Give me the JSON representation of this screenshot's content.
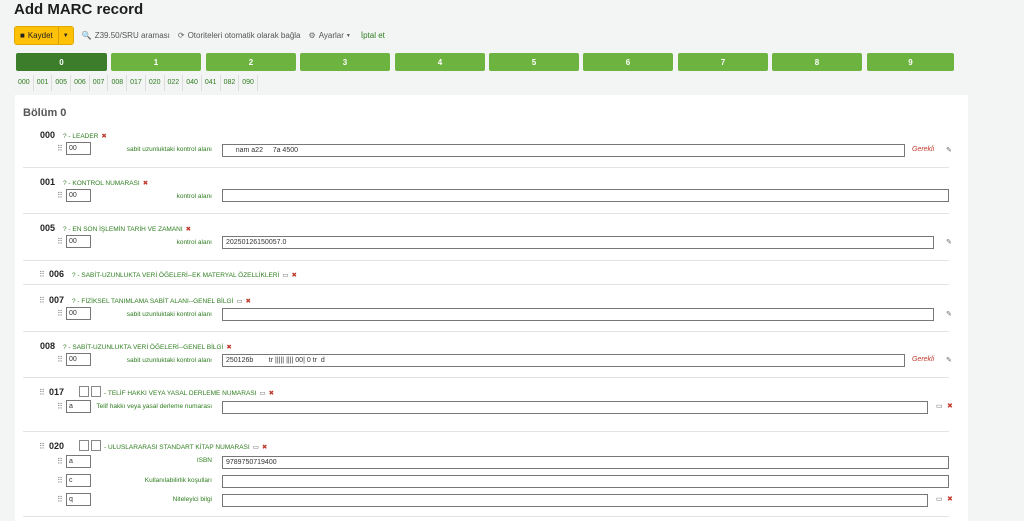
{
  "title": "Add MARC record",
  "toolbar": {
    "save_label": "Kaydet",
    "z3950_label": "Z39.50/SRU araması",
    "link_authorities_label": "Otoriteleri otomatik olarak bağla",
    "settings_label": "Ayarlar",
    "cancel_label": "İptal et"
  },
  "tabs": [
    "0",
    "1",
    "2",
    "3",
    "4",
    "5",
    "6",
    "7",
    "8",
    "9"
  ],
  "fieldnav": [
    "000",
    "001",
    "005",
    "006",
    "007",
    "008",
    "017",
    "020",
    "022",
    "040",
    "041",
    "082",
    "090"
  ],
  "section_title": "Bölüm 0",
  "fields": {
    "f000": {
      "tag": "000",
      "name": "? - LEADER",
      "code": "00",
      "label": "sabit uzunluktaki kontrol alanı",
      "value": "     nam a22     7a 4500",
      "required": "Gerekli"
    },
    "f001": {
      "tag": "001",
      "name": "? - KONTROL NUMARASI",
      "code": "00",
      "label": "kontrol alanı",
      "value": ""
    },
    "f005": {
      "tag": "005",
      "name": "? - EN SON İŞLEMİN TARİH VE ZAMANI",
      "code": "00",
      "label": "kontrol alanı",
      "value": "20250126150057.0"
    },
    "f006": {
      "tag": "006",
      "name": "? - SABİT-UZUNLUKTA VERİ ÖĞELERİ--EK MATERYAL ÖZELLİKLERİ"
    },
    "f007": {
      "tag": "007",
      "name": "? - FİZİKSEL TANIMLAMA SABİT ALANI--GENEL BİLGİ",
      "code": "00",
      "label": "sabit uzunluktaki kontrol alanı",
      "value": ""
    },
    "f008": {
      "tag": "008",
      "name": "? - SABİT-UZUNLUKTA VERİ ÖĞELERİ--GENEL BİLGİ",
      "code": "00",
      "label": "sabit uzunluktaki kontrol alanı",
      "value": "250126b        tr ||||| |||| 00| 0 tr  d",
      "required": "Gerekli"
    },
    "f017": {
      "tag": "017",
      "name": "- TELİF HAKKI VEYA YASAL DERLEME NUMARASI",
      "code": "a",
      "label": "Telif hakkı veya yasal derleme numarası",
      "value": ""
    },
    "f020": {
      "tag": "020",
      "name": "- ULUSLARARASI STANDART KİTAP NUMARASI",
      "sub": [
        {
          "code": "a",
          "label": "ISBN",
          "value": "9789750719400"
        },
        {
          "code": "c",
          "label": "Kullanılabilirlik koşulları",
          "value": ""
        },
        {
          "code": "q",
          "label": "Niteleyici bilgi",
          "value": ""
        }
      ]
    }
  }
}
